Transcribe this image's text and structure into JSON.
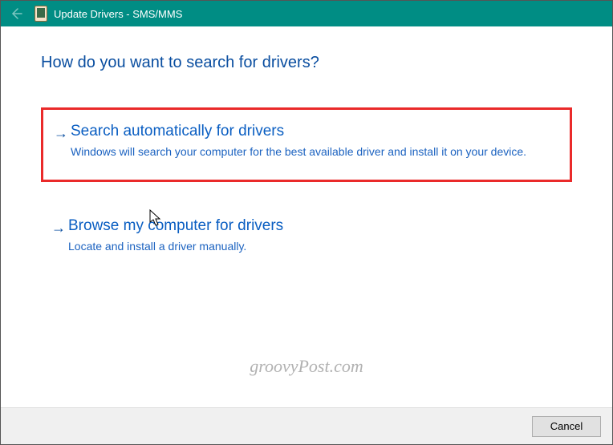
{
  "titlebar": {
    "title": "Update Drivers - SMS/MMS"
  },
  "heading": "How do you want to search for drivers?",
  "options": [
    {
      "title": "Search automatically for drivers",
      "desc": "Windows will search your computer for the best available driver and install it on your device."
    },
    {
      "title": "Browse my computer for drivers",
      "desc": "Locate and install a driver manually."
    }
  ],
  "footer": {
    "cancel": "Cancel"
  },
  "watermark": "groovyPost.com"
}
